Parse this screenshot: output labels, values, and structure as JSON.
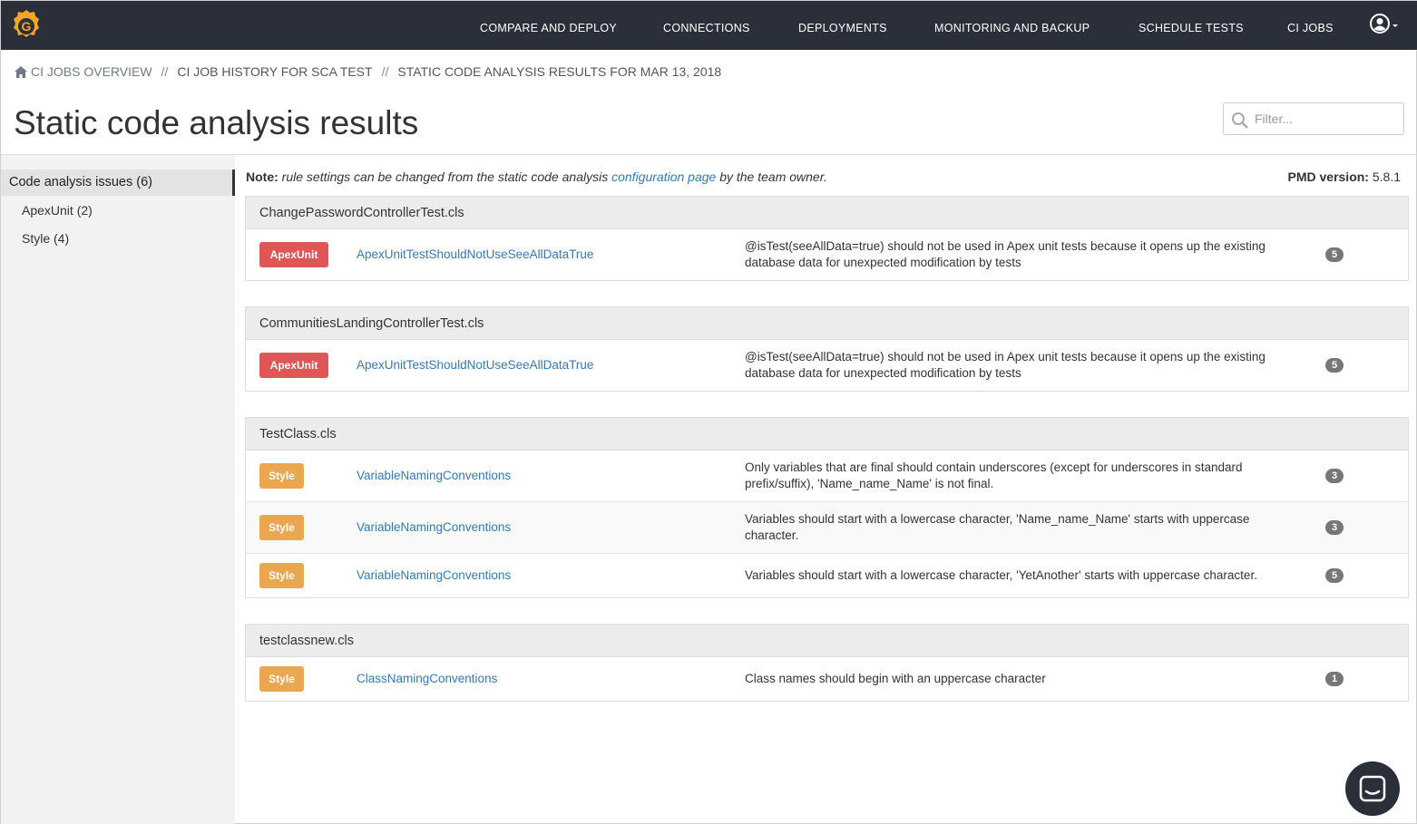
{
  "nav": {
    "items": [
      "COMPARE AND DEPLOY",
      "CONNECTIONS",
      "DEPLOYMENTS",
      "MONITORING AND BACKUP",
      "SCHEDULE TESTS",
      "CI JOBS"
    ]
  },
  "breadcrumb": {
    "home": "CI JOBS OVERVIEW",
    "sep": "//",
    "job": "CI JOB HISTORY FOR SCA TEST",
    "current": "STATIC CODE ANALYSIS RESULTS FOR MAR 13, 2018"
  },
  "page": {
    "title": "Static code analysis results",
    "filter_placeholder": "Filter..."
  },
  "sidebar": {
    "active": "Code analysis issues (6)",
    "items": [
      "ApexUnit (2)",
      "Style (4)"
    ]
  },
  "note": {
    "label": "Note:",
    "text_before": " rule settings can be changed from the static code analysis ",
    "link": "configuration page",
    "text_after": " by the team owner."
  },
  "pmd": {
    "label": "PMD version:",
    "value": " 5.8.1"
  },
  "panels": [
    {
      "file": "ChangePasswordControllerTest.cls",
      "rows": [
        {
          "category": "ApexUnit",
          "rule": "ApexUnitTestShouldNotUseSeeAllDataTrue",
          "description": "@isTest(seeAllData=true) should not be used in Apex unit tests because it opens up the existing database data for unexpected modification by tests",
          "priority": "5"
        }
      ]
    },
    {
      "file": "CommunitiesLandingControllerTest.cls",
      "rows": [
        {
          "category": "ApexUnit",
          "rule": "ApexUnitTestShouldNotUseSeeAllDataTrue",
          "description": "@isTest(seeAllData=true) should not be used in Apex unit tests because it opens up the existing database data for unexpected modification by tests",
          "priority": "5"
        }
      ]
    },
    {
      "file": "TestClass.cls",
      "rows": [
        {
          "category": "Style",
          "rule": "VariableNamingConventions",
          "description": "Only variables that are final should contain underscores (except for underscores in standard prefix/suffix), 'Name_name_Name' is not final.",
          "priority": "3"
        },
        {
          "category": "Style",
          "rule": "VariableNamingConventions",
          "description": "Variables should start with a lowercase character, 'Name_name_Name' starts with uppercase character.",
          "priority": "3"
        },
        {
          "category": "Style",
          "rule": "VariableNamingConventions",
          "description": "Variables should start with a lowercase character, 'YetAnother' starts with uppercase character.",
          "priority": "5"
        }
      ]
    },
    {
      "file": "testclassnew.cls",
      "rows": [
        {
          "category": "Style",
          "rule": "ClassNamingConventions",
          "description": "Class names should begin with an uppercase character",
          "priority": "1"
        }
      ]
    }
  ],
  "colors": {
    "nav_bg": "#2b2f3a",
    "apex_badge": "#e05656",
    "style_badge": "#eba74f",
    "link": "#337ab7",
    "count_badge": "#777777",
    "logo": "#f5a623"
  },
  "icons": {
    "logo": "gearset-logo",
    "user": "user-circle-icon",
    "home": "home-icon",
    "search": "search-icon",
    "chat": "chat-icon"
  }
}
